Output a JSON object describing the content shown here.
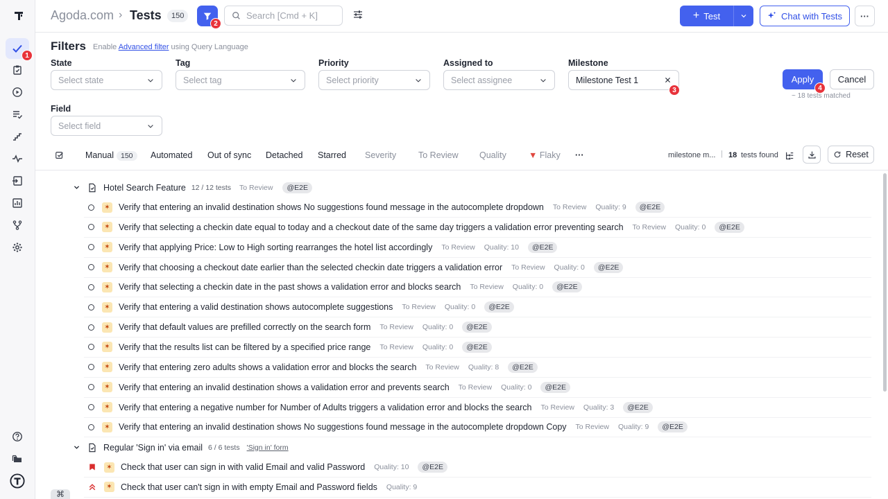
{
  "header": {
    "project": "Agoda.com",
    "separator": "›",
    "title": "Tests",
    "count": "150",
    "search_placeholder": "Search [Cmd + K]",
    "test_button": "Test",
    "chat_button": "Chat with Tests",
    "more": "···"
  },
  "annotations": {
    "n1": "1",
    "n2": "2",
    "n3": "3",
    "n4": "4"
  },
  "filters": {
    "title": "Filters",
    "hint_prefix": "Enable",
    "hint_link": "Advanced filter",
    "hint_suffix": "using Query Language",
    "state_label": "State",
    "state_placeholder": "Select state",
    "tag_label": "Tag",
    "tag_placeholder": "Select tag",
    "priority_label": "Priority",
    "priority_placeholder": "Select priority",
    "assigned_label": "Assigned to",
    "assigned_placeholder": "Select assignee",
    "milestone_label": "Milestone",
    "milestone_value": "Milestone Test 1",
    "field_label": "Field",
    "field_placeholder": "Select field",
    "apply": "Apply",
    "cancel": "Cancel",
    "matched": "~ 18 tests matched"
  },
  "tabs": {
    "manual": "Manual",
    "manual_count": "150",
    "automated": "Automated",
    "out_of_sync": "Out of sync",
    "detached": "Detached",
    "starred": "Starred",
    "severity": "Severity",
    "to_review": "To Review",
    "quality": "Quality",
    "flaky": "Flaky",
    "more": "···",
    "milestone_short": "milestone m...",
    "found_count": "18",
    "found_label": "tests found",
    "reset": "Reset"
  },
  "suites": [
    {
      "name": "Hotel Search Feature",
      "count": "12 / 12 tests",
      "status": "To Review",
      "tag": "@E2E"
    },
    {
      "name": "Regular 'Sign in' via email",
      "count": "6 / 6 tests",
      "link": "'Sign in' form"
    }
  ],
  "tests": [
    {
      "title": "Verify that entering an invalid destination shows No suggestions found message in the autocomplete dropdown",
      "status": "To Review",
      "quality": "Quality: 9",
      "tag": "@E2E"
    },
    {
      "title": "Verify that selecting a checkin date equal to today and a checkout date of the same day triggers a validation error preventing search",
      "status": "To Review",
      "quality": "Quality: 0",
      "tag": "@E2E"
    },
    {
      "title": "Verify that applying Price: Low to High sorting rearranges the hotel list accordingly",
      "status": "To Review",
      "quality": "Quality: 10",
      "tag": "@E2E"
    },
    {
      "title": "Verify that choosing a checkout date earlier than the selected checkin date triggers a validation error",
      "status": "To Review",
      "quality": "Quality: 0",
      "tag": "@E2E"
    },
    {
      "title": "Verify that selecting a checkin date in the past shows a validation error and blocks search",
      "status": "To Review",
      "quality": "Quality: 0",
      "tag": "@E2E"
    },
    {
      "title": "Verify that entering a valid destination shows autocomplete suggestions",
      "status": "To Review",
      "quality": "Quality: 0",
      "tag": "@E2E"
    },
    {
      "title": "Verify that default values are prefilled correctly on the search form",
      "status": "To Review",
      "quality": "Quality: 0",
      "tag": "@E2E"
    },
    {
      "title": "Verify that the results list can be filtered by a specified price range",
      "status": "To Review",
      "quality": "Quality: 0",
      "tag": "@E2E"
    },
    {
      "title": "Verify that entering zero adults shows a validation error and blocks the search",
      "status": "To Review",
      "quality": "Quality: 8",
      "tag": "@E2E"
    },
    {
      "title": "Verify that entering an invalid destination shows a validation error and prevents search",
      "status": "To Review",
      "quality": "Quality: 0",
      "tag": "@E2E"
    },
    {
      "title": "Verify that entering a negative number for Number of Adults triggers a validation error and blocks the search",
      "status": "To Review",
      "quality": "Quality: 3",
      "tag": "@E2E"
    },
    {
      "title": "Verify that entering an invalid destination shows No suggestions found message in the autocomplete dropdown Copy",
      "status": "To Review",
      "quality": "Quality: 9",
      "tag": "@E2E"
    }
  ],
  "signin_tests": [
    {
      "title": "Check that user can sign in with valid Email and valid Password",
      "quality": "Quality: 10",
      "tag": "@E2E"
    },
    {
      "title": "Check that user can't sign in with empty Email and Password fields",
      "quality": "Quality: 9"
    }
  ],
  "kbd": "⌘"
}
